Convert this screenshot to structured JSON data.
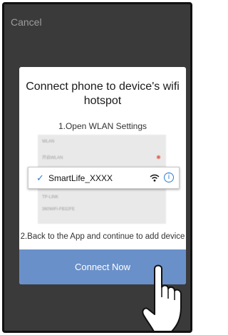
{
  "cancel_label": "Cancel",
  "dialog": {
    "title": "Connect phone to device's wifi hotspot",
    "step1": "1.Open WLAN Settings",
    "screenshot": {
      "header": "WLAN",
      "row1": "开启WLAN",
      "ssid": "SmartLife_XXXX",
      "blur_row3": "TP-LINK",
      "blur_row4": "360WiFi-FB32FE"
    },
    "step2": "2.Back to the App and continue to add device",
    "button": "Connect Now"
  },
  "colors": {
    "accent": "#6a90c9",
    "check": "#2b7cd3",
    "overlay": "#3a3a3a"
  }
}
